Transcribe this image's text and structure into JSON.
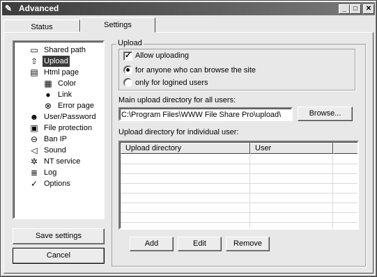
{
  "window": {
    "title": "Advanced",
    "minimize": "_",
    "maximize": "□",
    "close": "✕"
  },
  "tabs": [
    {
      "label": "Status",
      "active": false
    },
    {
      "label": "Settings",
      "active": true
    }
  ],
  "tree": {
    "items": [
      {
        "label": "Shared path",
        "icon": "folder-icon",
        "glyph": "▭"
      },
      {
        "label": "Upload",
        "icon": "upload-arrow-icon",
        "glyph": "⇧",
        "selected": true
      },
      {
        "label": "Html page",
        "icon": "html-page-icon",
        "glyph": "▤"
      },
      {
        "label": "Color",
        "icon": "color-icon",
        "glyph": "▦"
      },
      {
        "label": "Link",
        "icon": "link-icon",
        "glyph": "●"
      },
      {
        "label": "Error page",
        "icon": "error-icon",
        "glyph": "⊗"
      },
      {
        "label": "User/Password",
        "icon": "user-icon",
        "glyph": "☻"
      },
      {
        "label": "File protection",
        "icon": "lock-icon",
        "glyph": "🔒"
      },
      {
        "label": "Ban IP",
        "icon": "ban-icon",
        "glyph": "⊖"
      },
      {
        "label": "Sound",
        "icon": "speaker-icon",
        "glyph": "◁"
      },
      {
        "label": "NT service",
        "icon": "service-gear-icon",
        "glyph": "✲"
      },
      {
        "label": "Log",
        "icon": "log-icon",
        "glyph": "≣"
      },
      {
        "label": "Options",
        "icon": "checkmark-icon",
        "glyph": "✓"
      }
    ]
  },
  "buttons": {
    "save": "Save settings",
    "cancel": "Cancel",
    "browse": "Browse...",
    "add": "Add",
    "edit": "Edit",
    "remove": "Remove"
  },
  "upload": {
    "group_label": "Upload",
    "allow_label": "Allow uploading",
    "allow_checked": true,
    "option_anyone": "for anyone who can browse the site",
    "option_logged": "only for logined users",
    "selected_option": "anyone",
    "main_dir_label": "Main upload directory for all users:",
    "main_dir_value": "C:\\Program Files\\WWW File Share Pro\\upload\\",
    "individual_label": "Upload directory for individual user:",
    "columns": [
      "Upload directory",
      "User"
    ]
  }
}
